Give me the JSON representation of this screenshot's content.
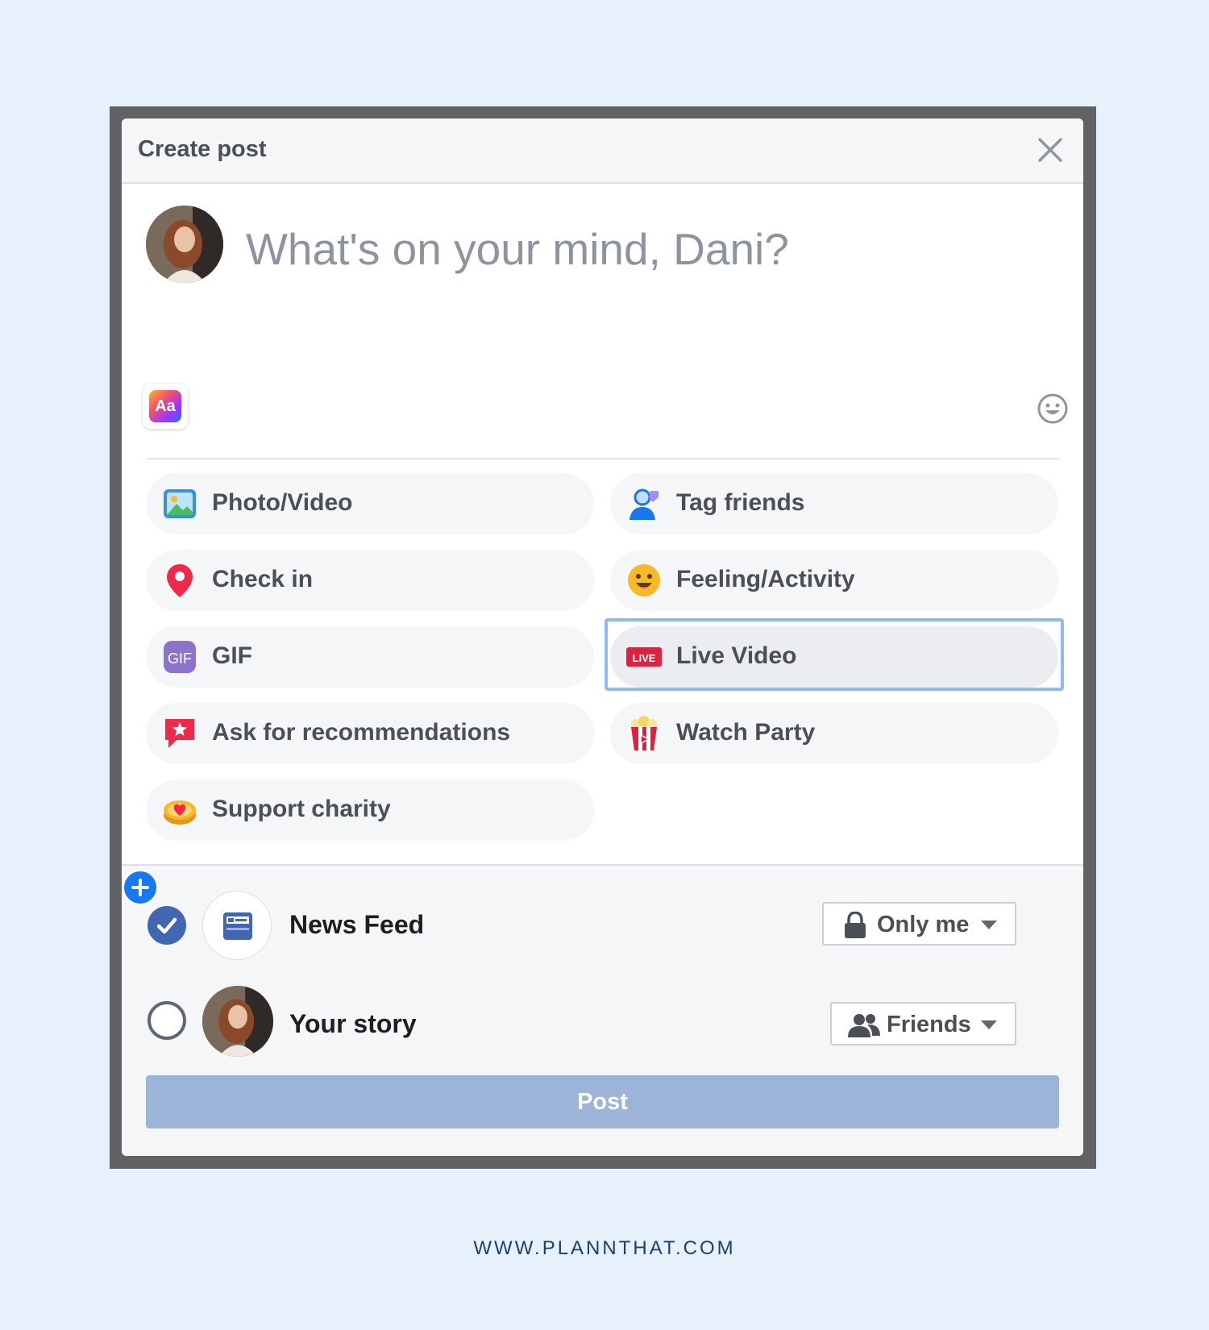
{
  "dialog": {
    "title": "Create post",
    "close_icon": "close-icon"
  },
  "composer": {
    "placeholder": "What's on your mind, Dani?",
    "text_style_label": "Aa",
    "emoji_icon": "smiley-icon"
  },
  "options": [
    {
      "id": "photo-video",
      "label": "Photo/Video",
      "icon": "photo-icon"
    },
    {
      "id": "tag-friends",
      "label": "Tag friends",
      "icon": "tag-friends-icon"
    },
    {
      "id": "check-in",
      "label": "Check in",
      "icon": "location-pin-icon"
    },
    {
      "id": "feeling-activity",
      "label": "Feeling/Activity",
      "icon": "smiley-emoji-icon"
    },
    {
      "id": "gif",
      "label": "GIF",
      "icon": "gif-icon",
      "icon_text": "GIF"
    },
    {
      "id": "live-video",
      "label": "Live Video",
      "icon": "live-icon",
      "icon_text": "LIVE",
      "selected": true
    },
    {
      "id": "ask-recommendations",
      "label": "Ask for recommendations",
      "icon": "recommendation-icon"
    },
    {
      "id": "watch-party",
      "label": "Watch Party",
      "icon": "popcorn-icon"
    },
    {
      "id": "support-charity",
      "label": "Support charity",
      "icon": "charity-heart-icon"
    }
  ],
  "share": {
    "news_feed": {
      "label": "News Feed",
      "checked": true,
      "audience": "Only me",
      "audience_icon": "lock-icon"
    },
    "your_story": {
      "label": "Your story",
      "checked": false,
      "audience": "Friends",
      "audience_icon": "friends-icon"
    }
  },
  "post_button": "Post",
  "footer_url": "WWW.PLANNTHAT.COM",
  "colors": {
    "background": "#e6f1fc",
    "brand_blue": "#4267b2",
    "post_disabled": "#9cb4d8",
    "focus_ring": "#8bbcf5"
  }
}
